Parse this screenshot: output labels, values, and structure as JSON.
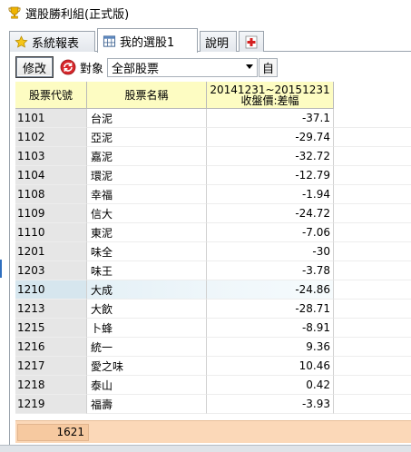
{
  "window": {
    "title": "選股勝利組(正式版)"
  },
  "tabs": [
    {
      "label": "系統報表"
    },
    {
      "label": "我的選股1"
    },
    {
      "label": "說明"
    }
  ],
  "toolbar": {
    "edit_label": "修改",
    "target_label": "對象",
    "target_value": "全部股票",
    "self_label": "自"
  },
  "grid": {
    "headers": {
      "code": "股票代號",
      "name": "股票名稱",
      "change_line1": "20141231~20151231",
      "change_line2": "收盤價:差幅"
    },
    "rows": [
      {
        "code": "1101",
        "name": "台泥",
        "change": "-37.1"
      },
      {
        "code": "1102",
        "name": "亞泥",
        "change": "-29.74"
      },
      {
        "code": "1103",
        "name": "嘉泥",
        "change": "-32.72"
      },
      {
        "code": "1104",
        "name": "環泥",
        "change": "-12.79"
      },
      {
        "code": "1108",
        "name": "幸福",
        "change": "-1.94"
      },
      {
        "code": "1109",
        "name": "信大",
        "change": "-24.72"
      },
      {
        "code": "1110",
        "name": "東泥",
        "change": "-7.06"
      },
      {
        "code": "1201",
        "name": "味全",
        "change": "-30"
      },
      {
        "code": "1203",
        "name": "味王",
        "change": "-3.78"
      },
      {
        "code": "1210",
        "name": "大成",
        "change": "-24.86"
      },
      {
        "code": "1213",
        "name": "大飲",
        "change": "-28.71"
      },
      {
        "code": "1215",
        "name": "卜蜂",
        "change": "-8.91"
      },
      {
        "code": "1216",
        "name": "統一",
        "change": "9.36"
      },
      {
        "code": "1217",
        "name": "愛之味",
        "change": "10.46"
      },
      {
        "code": "1218",
        "name": "泰山",
        "change": "0.42"
      },
      {
        "code": "1219",
        "name": "福壽",
        "change": "-3.93"
      }
    ],
    "highlight_row": 9,
    "footer_count": "1621"
  },
  "colors": {
    "header_bg": "#fdfcc2",
    "code_col_bg": "#e6e6e6",
    "footer_bg": "#fbd8b8",
    "highlight": "#d6e6ee"
  },
  "icons": {
    "title": "trophy-icon",
    "tab_system": "star-icon",
    "tab_mine": "table-icon",
    "tab_add": "add-tab-icon",
    "refresh": "refresh-icon"
  }
}
